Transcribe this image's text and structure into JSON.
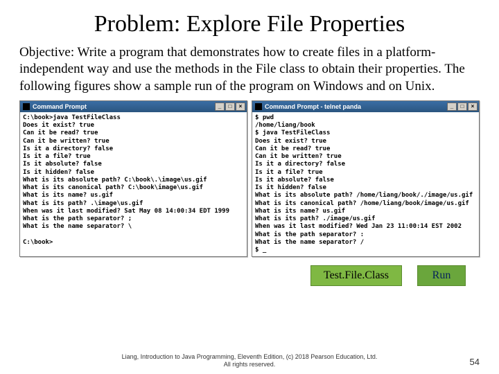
{
  "title": "Problem: Explore File Properties",
  "objective": "Objective: Write a program that demonstrates how to create files in a platform-independent way and use the methods in the File class to obtain their properties. The following figures show a sample run of the program on Windows and on Unix.",
  "left_terminal": {
    "title": "Command Prompt",
    "min": "_",
    "max": "□",
    "close": "×",
    "body": "C:\\book>java TestFileClass\nDoes it exist? true\nCan it be read? true\nCan it be written? true\nIs it a directory? false\nIs it a file? true\nIs it absolute? false\nIs it hidden? false\nWhat is its absolute path? C:\\book\\.\\image\\us.gif\nWhat is its canonical path? C:\\book\\image\\us.gif\nWhat is its name? us.gif\nWhat is its path? .\\image\\us.gif\nWhen was it last modified? Sat May 08 14:00:34 EDT 1999\nWhat is the path separator? ;\nWhat is the name separator? \\\n\nC:\\book>"
  },
  "right_terminal": {
    "title": "Command Prompt - telnet panda",
    "min": "_",
    "max": "□",
    "close": "×",
    "body": "$ pwd\n/home/liang/book\n$ java TestFileClass\nDoes it exist? true\nCan it be read? true\nCan it be written? true\nIs it a directory? false\nIs it a file? true\nIs it absolute? false\nIs it hidden? false\nWhat is its absolute path? /home/liang/book/./image/us.gif\nWhat is its canonical path? /home/liang/book/image/us.gif\nWhat is its name? us.gif\nWhat is its path? ./image/us.gif\nWhen was it last modified? Wed Jan 23 11:00:14 EST 2002\nWhat is the path separator? :\nWhat is the name separator? /\n$ _"
  },
  "buttons": {
    "test_file_class": "Test.File.Class",
    "run": "Run"
  },
  "footer": {
    "line1": "Liang, Introduction to Java Programming, Eleventh Edition, (c) 2018 Pearson Education, Ltd.",
    "line2": "All rights reserved."
  },
  "page_number": "54"
}
